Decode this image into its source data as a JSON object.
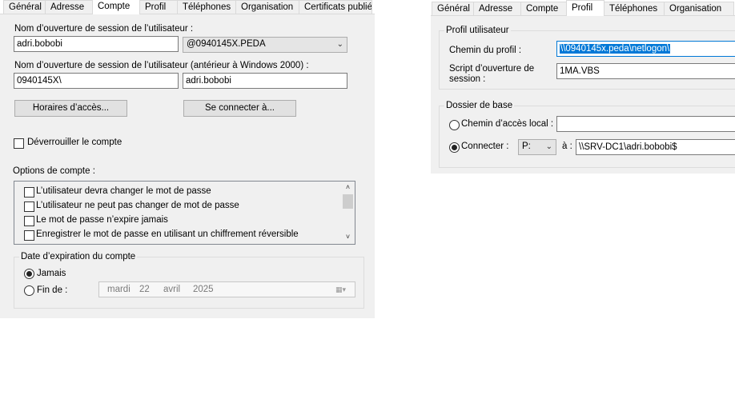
{
  "left": {
    "tabs": [
      "Général",
      "Adresse",
      "Compte",
      "Profil",
      "Téléphones",
      "Organisation",
      "Certificats publiés"
    ],
    "active_tab": "Compte",
    "logon_name_label": "Nom d’ouverture de session de l’utilisateur :",
    "logon_name_value": "adri.bobobi",
    "domain_suffix": "@0940145X.PEDA",
    "pre2000_label": "Nom d’ouverture de session de l’utilisateur (antérieur à Windows 2000) :",
    "pre2000_domain": "0940145X\\",
    "pre2000_user": "adri.bobobi",
    "logon_hours_button": "Horaires d’accès...",
    "logon_to_button": "Se connecter à...",
    "unlock_label": "Déverrouiller le compte",
    "account_options_label": "Options de compte :",
    "account_options": [
      "L’utilisateur devra changer le mot de passe",
      "L’utilisateur ne peut pas changer de mot de passe",
      "Le mot de passe n’expire jamais",
      "Enregistrer le mot de passe en utilisant un chiffrement réversible"
    ],
    "expiry_group_label": "Date d’expiration du compte",
    "never_label": "Jamais",
    "end_of_label": "Fin de :",
    "date": {
      "weekday": "mardi",
      "day": "22",
      "month": "avril",
      "year": "2025"
    }
  },
  "right": {
    "tabs": [
      "Général",
      "Adresse",
      "Compte",
      "Profil",
      "Téléphones",
      "Organisation"
    ],
    "active_tab": "Profil",
    "profile_group_label": "Profil utilisateur",
    "profile_path_label": "Chemin du profil :",
    "profile_path_value": "\\\\0940145x.peda\\netlogon\\",
    "logon_script_label_1": "Script d’ouverture de",
    "logon_script_label_2": "session :",
    "logon_script_value": "1MA.VBS",
    "home_group_label": "Dossier de base",
    "local_path_label": "Chemin d’accès local :",
    "local_path_value": "",
    "connect_label": "Connecter :",
    "drive_value": "P:",
    "to_label": "à :",
    "connect_path_value": "\\\\SRV-DC1\\adri.bobobi$"
  },
  "colors": {
    "panel": "#f0f0f0",
    "selection": "#0078d7",
    "border": "#7a7a7a"
  }
}
